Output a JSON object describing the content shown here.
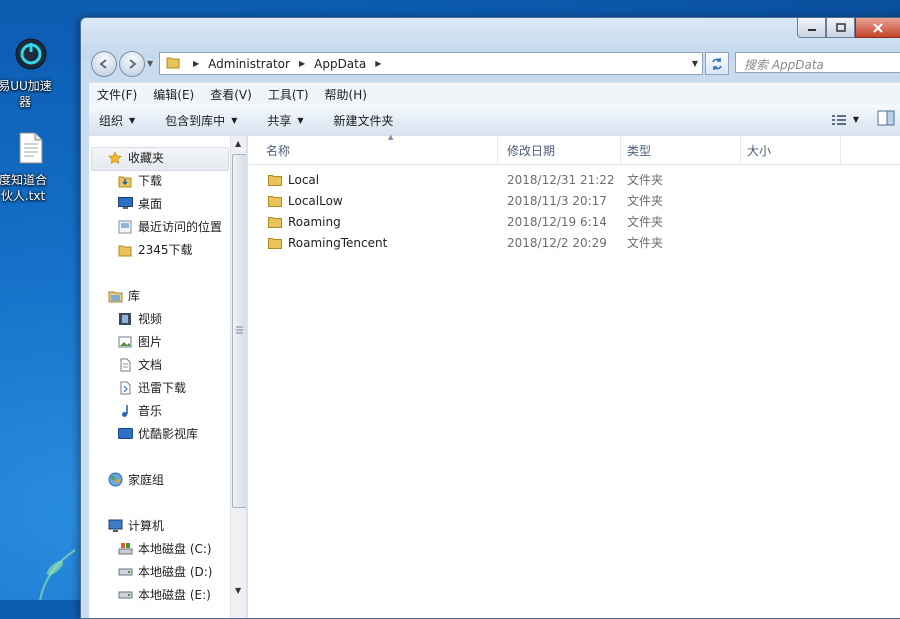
{
  "desktop": {
    "icons": [
      {
        "label": "易UU加速器"
      },
      {
        "label": "度知道合伙人.txt"
      }
    ]
  },
  "window": {
    "address": {
      "segments": [
        "Administrator",
        "AppData"
      ]
    },
    "search_placeholder": "搜索 AppData",
    "menu": [
      "文件(F)",
      "编辑(E)",
      "查看(V)",
      "工具(T)",
      "帮助(H)"
    ],
    "toolbar": {
      "organize": "组织",
      "include_library": "包含到库中",
      "share": "共享",
      "new_folder": "新建文件夹"
    },
    "nav": {
      "favorites": "收藏夹",
      "fav_items": [
        "下载",
        "桌面",
        "最近访问的位置",
        "2345下载"
      ],
      "libraries": "库",
      "lib_items": [
        "视频",
        "图片",
        "文档",
        "迅雷下载",
        "音乐",
        "优酷影视库"
      ],
      "homegroup": "家庭组",
      "computer": "计算机",
      "drives": [
        "本地磁盘 (C:)",
        "本地磁盘 (D:)",
        "本地磁盘 (E:)"
      ]
    },
    "columns": {
      "name": "名称",
      "modified": "修改日期",
      "type": "类型",
      "size": "大小"
    },
    "files": [
      {
        "name": "Local",
        "modified": "2018/12/31 21:22",
        "type": "文件夹"
      },
      {
        "name": "LocalLow",
        "modified": "2018/11/3 20:17",
        "type": "文件夹"
      },
      {
        "name": "Roaming",
        "modified": "2018/12/19 6:14",
        "type": "文件夹"
      },
      {
        "name": "RoamingTencent",
        "modified": "2018/12/2 20:29",
        "type": "文件夹"
      }
    ]
  },
  "colors": {
    "accent": "#1470c8",
    "folder": "#e8c45a"
  }
}
